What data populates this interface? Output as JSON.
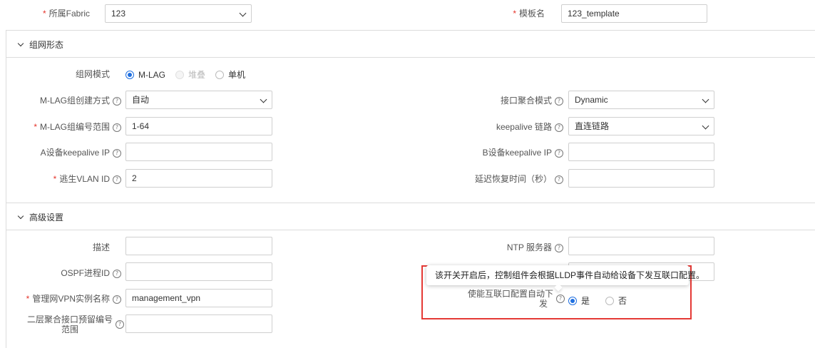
{
  "top": {
    "fabric_label": "所属Fabric",
    "fabric_value": "123",
    "template_label": "模板名",
    "template_value": "123_template"
  },
  "networking": {
    "section_title": "组网形态",
    "mode_label": "组网模式",
    "mode_options": [
      {
        "label": "M-LAG",
        "state": "checked"
      },
      {
        "label": "堆叠",
        "state": "disabled"
      },
      {
        "label": "单机",
        "state": "unchecked"
      }
    ],
    "mlag_create_label": "M-LAG组创建方式",
    "mlag_create_value": "自动",
    "lacp_mode_label": "接口聚合模式",
    "lacp_mode_value": "Dynamic",
    "mlag_range_label": "M-LAG组编号范围",
    "mlag_range_value": "1-64",
    "keepalive_link_label": "keepalive 链路",
    "keepalive_link_value": "直连链路",
    "a_keepalive_label": "A设备keepalive IP",
    "a_keepalive_value": "",
    "b_keepalive_label": "B设备keepalive IP",
    "b_keepalive_value": "",
    "escape_vlan_label": "逃生VLAN ID",
    "escape_vlan_value": "2",
    "delay_label": "延迟恢复时间（秒）",
    "delay_value": ""
  },
  "advanced": {
    "section_title": "高级设置",
    "desc_label": "描述",
    "desc_value": "",
    "ntp_label": "NTP 服务器",
    "ntp_value": "",
    "ospf_label": "OSPF进程ID",
    "ospf_value": "",
    "mgmt_vpn_label": "管理网VPN实例名称",
    "mgmt_vpn_value": "management_vpn",
    "l2_range_label_line1": "二层聚合接口预留编号",
    "l2_range_label_line2": "范围",
    "l2_range_value": "",
    "auto_deliver_label_line1": "使能互联口配置自动下",
    "auto_deliver_label_line2": "发",
    "auto_deliver_options": [
      {
        "label": "是",
        "state": "checked"
      },
      {
        "label": "否",
        "state": "unchecked"
      }
    ],
    "tooltip_text": "该开关开启后，控制组件会根据LLDP事件自动给设备下发互联口配置。"
  },
  "icons": {
    "help": "?"
  },
  "colors": {
    "accent": "#1f6fe0",
    "required": "#e5342b",
    "highlight_border": "#e53935"
  }
}
